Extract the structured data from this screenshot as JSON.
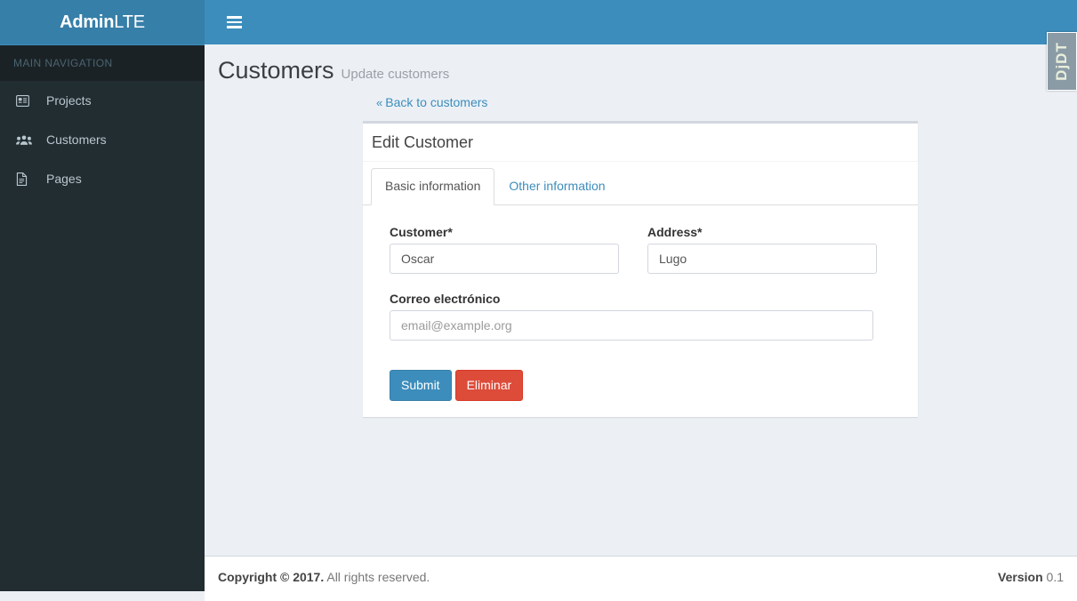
{
  "header": {
    "logo_strong": "Admin",
    "logo_light": "LTE",
    "toggle_icon": "hamburger-icon"
  },
  "sidebar": {
    "section_label": "MAIN NAVIGATION",
    "items": [
      {
        "label": "Projects",
        "icon": "id-card-icon"
      },
      {
        "label": "Customers",
        "icon": "users-group-icon"
      },
      {
        "label": "Pages",
        "icon": "file-text-icon"
      }
    ]
  },
  "page": {
    "title": "Customers",
    "subtitle": "Update customers",
    "back_link": "Back to customers",
    "back_chevron": "«"
  },
  "box": {
    "title": "Edit Customer",
    "tabs": [
      {
        "label": "Basic information",
        "active": true
      },
      {
        "label": "Other information",
        "active": false
      }
    ],
    "fields": {
      "customer": {
        "label": "Customer*",
        "value": "Oscar",
        "placeholder": ""
      },
      "address": {
        "label": "Address*",
        "value": "Lugo",
        "placeholder": ""
      },
      "email": {
        "label": "Correo electrónico",
        "value": "",
        "placeholder": "email@example.org"
      }
    },
    "buttons": {
      "submit": "Submit",
      "delete": "Eliminar"
    }
  },
  "footer": {
    "copyright_strong": "Copyright © 2017.",
    "copyright_rest": " All rights reserved.",
    "version_label": "Version",
    "version_number": "0.1"
  },
  "debug_toolbar": {
    "label": "DjDT"
  },
  "colors": {
    "brand_blue": "#3c8dbc",
    "logo_blue": "#367fa9",
    "sidebar_dark": "#222d32",
    "sidebar_header": "#1a2226",
    "content_bg": "#ecf0f5",
    "danger_red": "#dd4b39",
    "link_blue": "#3c8dbc"
  }
}
